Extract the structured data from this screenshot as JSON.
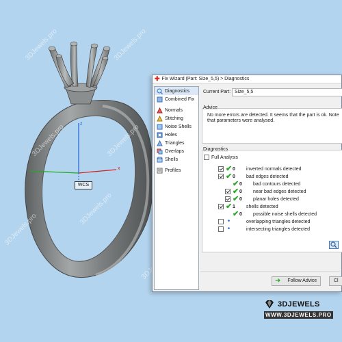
{
  "dialog": {
    "title": "Fix Wizard (Part: Size_5,5) > Diagnostics",
    "title_icon": "red-cross-icon"
  },
  "sidebar": {
    "items": [
      {
        "label": "Diagnostics",
        "icon": "diagnostics-icon",
        "selected": true
      },
      {
        "label": "Combined Fix",
        "icon": "combined-fix-icon"
      },
      {
        "label": "Normals",
        "icon": "normals-icon"
      },
      {
        "label": "Stitching",
        "icon": "stitching-icon"
      },
      {
        "label": "Noise Shells",
        "icon": "noise-shells-icon"
      },
      {
        "label": "Holes",
        "icon": "holes-icon"
      },
      {
        "label": "Triangles",
        "icon": "triangles-icon"
      },
      {
        "label": "Overlaps",
        "icon": "overlaps-icon"
      },
      {
        "label": "Shells",
        "icon": "shells-icon"
      },
      {
        "label": "Profiles",
        "icon": "profiles-icon"
      }
    ]
  },
  "main": {
    "current_part_label": "Current Part:",
    "current_part_value": "Size_5,5",
    "advice_title": "Advice",
    "advice_text": "No more errors are detected. It seems that the part is ok. Note that parameters were analysed.",
    "diagnostics_title": "Diagnostics",
    "full_analysis_label": "Full Analysis",
    "rows": [
      {
        "count": "0",
        "label": "inverted normals detected"
      },
      {
        "count": "0",
        "label": "bad edges detected"
      },
      {
        "count": "0",
        "label": "bad contours detected"
      },
      {
        "count": "0",
        "label": "near bad edges detected"
      },
      {
        "count": "0",
        "label": "planar holes detected"
      },
      {
        "count": "1",
        "label": "shells detected"
      },
      {
        "count": "0",
        "label": "possible noise shells detected"
      },
      {
        "count": "",
        "label": "overlapping triangles detected"
      },
      {
        "count": "",
        "label": "intersecting triangles detected"
      }
    ]
  },
  "footer": {
    "follow_advice": "Follow Advice",
    "close_partial": "Cl"
  },
  "viewport": {
    "axis_z": "z",
    "axis_x": "x",
    "wcs_label": "WCS"
  },
  "branding": {
    "name": "3DJEWELS",
    "url": "WWW.3DJEWELS.PRO",
    "watermark": "3DJewels.pro"
  },
  "colors": {
    "background": "#b3d4ee",
    "ring": "#7d8080",
    "check_green": "#2aa82a",
    "axis_red": "#d22020",
    "axis_green": "#22a822",
    "axis_blue": "#2060d0"
  }
}
